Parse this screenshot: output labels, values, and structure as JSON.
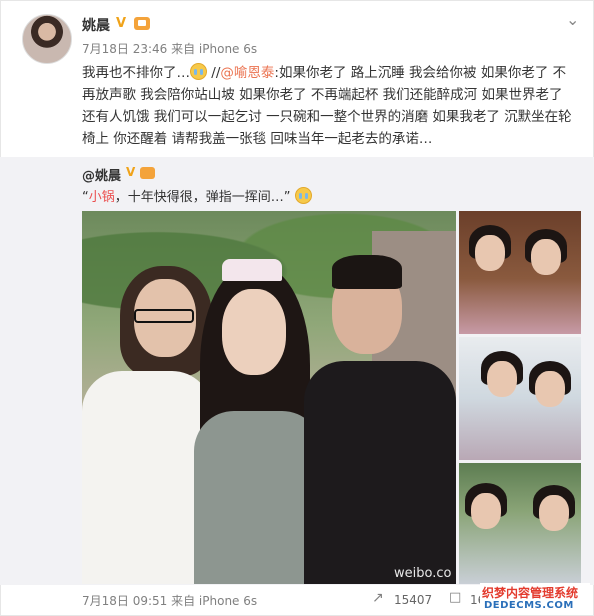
{
  "post": {
    "username": "姚晨",
    "verified_mark": "V",
    "meta": "7月18日 23:46 来自 iPhone 6s",
    "text_1": "我再也不排你了…",
    "text_2": "//",
    "mention": "@喻恩泰",
    "text_3": ":如果你老了 路上沉睡 我会给你被 如果你老了 不再放声歌 我会陪你站山坡 如果你老了 不再端起杯 我们还能醉成河 如果世界老了 还有人饥饿 我们可以一起乞讨 一只碗和一整个世界的消磨 如果我老了 沉默坐在轮椅上 你还醒着 请帮我盖一张毯 回味当年一起老去的承诺…",
    "menu_icon": "chevron-down-icon"
  },
  "repost": {
    "username": "@姚晨",
    "verified_mark": "V",
    "quote_open": "“",
    "quote_red": "小锅",
    "quote_text": "，十年快得很，弹指一挥间…”",
    "watermark": "weibo.co"
  },
  "footer": {
    "meta": "7月18日 09:51 来自 iPhone 6s",
    "share_icon": "share-icon",
    "repost_count": "15407",
    "comment_icon": "comment-icon",
    "comment_count": "16"
  },
  "site_mark": {
    "title": "织梦内容管理系统",
    "url": "DEDECMS.COM"
  }
}
